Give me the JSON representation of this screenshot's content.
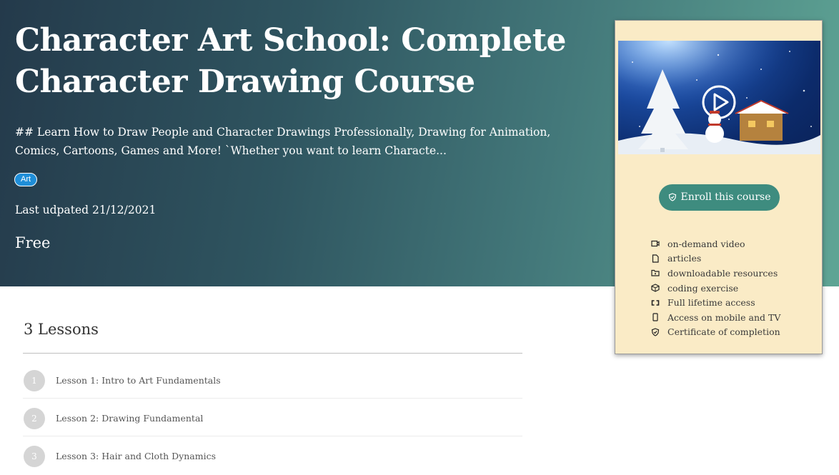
{
  "course": {
    "title": "Character Art School: Complete Character Drawing Course",
    "description": "## Learn How to Draw People and Character Drawings Professionally, Drawing for Animation, Comics, Cartoons, Games and More! `Whether you want to learn Characte...",
    "tag": "Art",
    "last_updated": "Last udpated 21/12/2021",
    "price": "Free"
  },
  "card": {
    "enroll_label": "Enroll this course",
    "features": [
      {
        "icon": "video-icon",
        "label": "on-demand video"
      },
      {
        "icon": "file-icon",
        "label": "articles"
      },
      {
        "icon": "folder-icon",
        "label": "downloadable resources"
      },
      {
        "icon": "code-icon",
        "label": "coding exercise"
      },
      {
        "icon": "infinity-icon",
        "label": "Full lifetime access"
      },
      {
        "icon": "mobile-icon",
        "label": "Access on mobile and TV"
      },
      {
        "icon": "certificate-icon",
        "label": "Certificate of completion"
      }
    ]
  },
  "lessons": {
    "heading": "3 Lessons",
    "items": [
      {
        "num": "1",
        "title": "Lesson 1: Intro to Art Fundamentals"
      },
      {
        "num": "2",
        "title": "Lesson 2: Drawing Fundamental"
      },
      {
        "num": "3",
        "title": "Lesson 3: Hair and Cloth Dynamics"
      }
    ]
  },
  "colors": {
    "hero_start": "#243a4b",
    "hero_end": "#5fa595",
    "card_bg": "#faebc6",
    "enroll_bg": "#3e8c7f",
    "tag_bg": "#1f8ed8"
  }
}
